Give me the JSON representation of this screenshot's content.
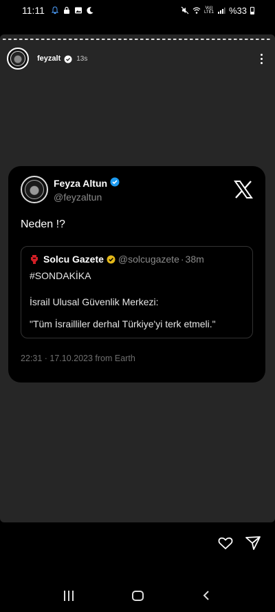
{
  "status_bar": {
    "time": "11:11",
    "network_type": "Vo)) LTE1",
    "battery": "%33",
    "icons": [
      "bell-icon",
      "lock-icon",
      "image-icon",
      "moon-icon",
      "mute-icon",
      "wifi-icon",
      "volte-icon",
      "signal-icon",
      "battery-icon"
    ]
  },
  "story": {
    "username": "feyzalt",
    "time_ago": "13s"
  },
  "tweet": {
    "author_name": "Feyza Altun",
    "author_handle": "@feyzaltun",
    "text": "Neden !?",
    "quote": {
      "name": "Solcu Gazete",
      "handle": "@solcugazete",
      "separator": "·",
      "time": "38m",
      "line1": "#SONDAKİKA",
      "line2": "İsrail Ulusal Güvenlik Merkezi:",
      "line3": "\"Tüm İsrailliler derhal Türkiye'yi terk etmeli.\""
    },
    "meta": "22:31 · 17.10.2023 from Earth"
  },
  "actions": {
    "icons": [
      "heart-icon",
      "send-icon"
    ]
  },
  "colors": {
    "background": "#000000",
    "story_background": "#262626",
    "verified_blue": "#1d9bf0",
    "verified_gold": "#e2b719",
    "muted_text": "#8b8b8b"
  }
}
